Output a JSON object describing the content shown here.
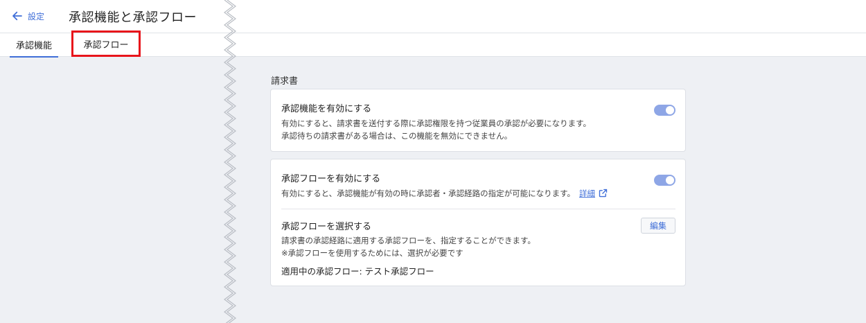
{
  "header": {
    "back_label": "設定",
    "title": "承認機能と承認フロー"
  },
  "tabs": [
    {
      "label": "承認機能",
      "active": true
    },
    {
      "label": "承認フロー",
      "active": false,
      "highlighted": true
    }
  ],
  "section": {
    "label": "請求書"
  },
  "card_approval": {
    "title": "承認機能を有効にする",
    "desc_line1": "有効にすると、請求書を送付する際に承認権限を持つ従業員の承認が必要になります。",
    "desc_line2": "承認待ちの請求書がある場合は、この機能を無効にできません。",
    "toggle_on": true
  },
  "card_flow": {
    "title": "承認フローを有効にする",
    "desc": "有効にすると、承認機能が有効の時に承認者・承認経路の指定が可能になります。",
    "detail_link": "詳細",
    "toggle_on": true,
    "select_title": "承認フローを選択する",
    "select_desc_line1": "請求書の承認経路に適用する承認フローを、指定することができます。",
    "select_desc_line2": "※承認フローを使用するためには、選択が必要です",
    "edit_label": "編集",
    "applied_text": "適用中の承認フロー: テスト承認フロー"
  },
  "colors": {
    "accent": "#3f6ed8",
    "toggle": "#8ea6e6",
    "highlight_box": "#e8141b",
    "background": "#eef0f4"
  },
  "icons": {
    "back": "arrow-left-icon",
    "external": "external-link-icon",
    "toggle": "toggle-switch"
  }
}
